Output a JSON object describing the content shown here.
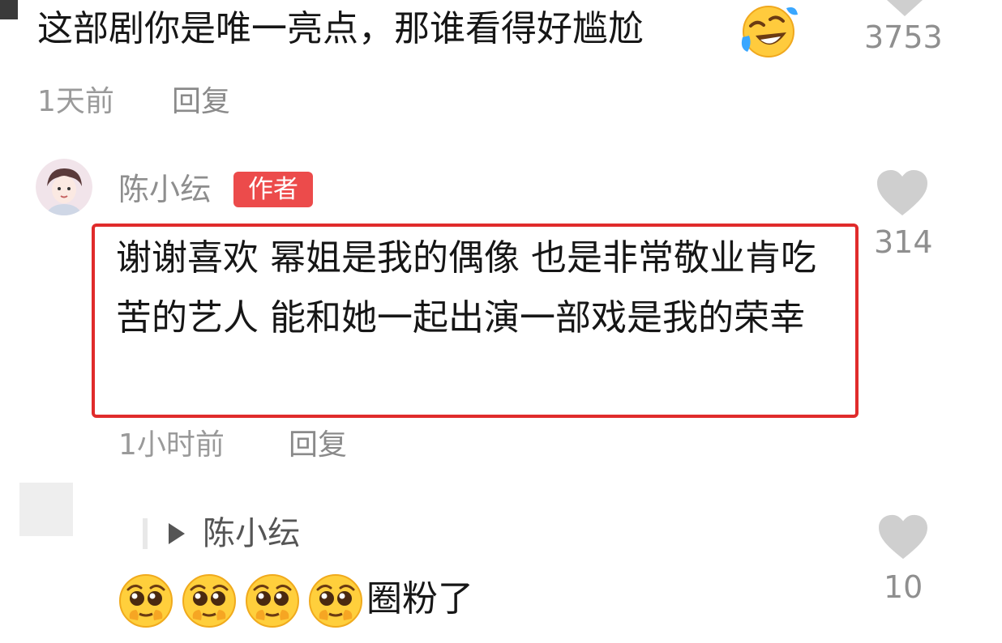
{
  "comment1": {
    "text": "这部剧你是唯一亮点，那谁看得好尴尬",
    "emoji": "rolling-on-floor-laughing-emoji",
    "time": "1天前",
    "reply_label": "回复",
    "like_count": "3753"
  },
  "author_reply": {
    "name": "陈小纭",
    "badge": "作者",
    "text": "谢谢喜欢 幂姐是我的偶像 也是非常敬业肯吃苦的艺人 能和她一起出演一部戏是我的荣幸",
    "time": "1小时前",
    "reply_label": "回复",
    "like_count": "314",
    "highlight_color": "#e02b2b",
    "badge_color": "#ec4b4b"
  },
  "sub_reply": {
    "reply_to": "陈小纭",
    "emoji": "pleading-face-emoji",
    "emoji_count": 4,
    "text": "圈粉了",
    "like_count": "10"
  }
}
